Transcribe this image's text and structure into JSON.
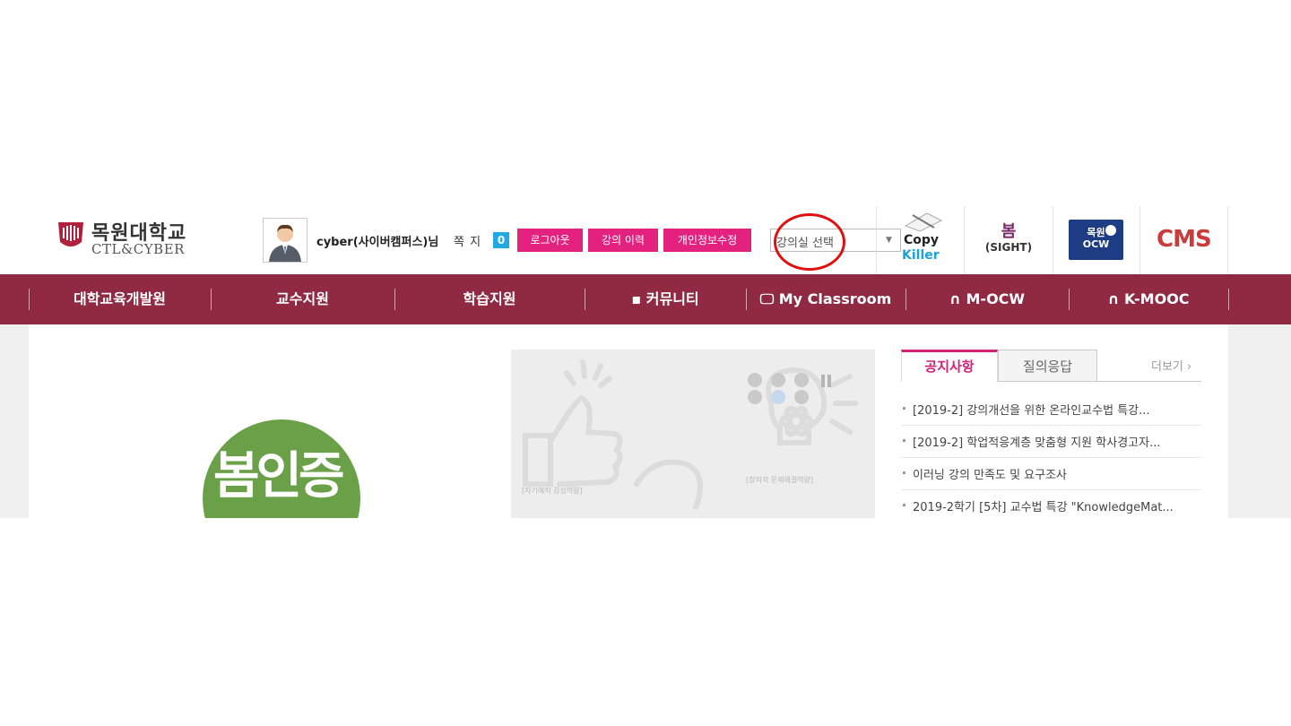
{
  "header": {
    "logo_title": "목원대학교",
    "logo_subtitle": "CTL&CYBER",
    "username": "cyber(사이버캠퍼스)님",
    "message_label": "쪽 지",
    "message_count": "0",
    "logout_label": "로그아웃",
    "history_label": "강의 이력",
    "profile_edit_label": "개인정보수정",
    "course_select": {
      "selected": "강의실 선택"
    },
    "services": {
      "copykiller_line1": "Copy",
      "copykiller_line2": "Killer",
      "sight_top": "봄",
      "sight_bottom": "(SIGHT)",
      "ocw_line1": "목원",
      "ocw_line2": "OCW",
      "cms_label": "CMS"
    }
  },
  "nav": {
    "items": [
      "대학교육개발원",
      "교수지원",
      "학습지원",
      "커뮤니티",
      "My Classroom",
      "M-OCW",
      "K-MOOC"
    ]
  },
  "main": {
    "bom_badge": "봄인증",
    "banner": {
      "caption_left": "[자기애적 감성역량]",
      "caption_right": "[창의적 문제해결역량]"
    },
    "board": {
      "tabs": [
        "공지사항",
        "질의응답"
      ],
      "more_label": "더보기",
      "notices": [
        "[2019-2] 강의개선을 위한 온라인교수법 특강...",
        "[2019-2] 학업적응계층 맞춤형 지원 학사경고자...",
        "이러닝 강의 만족도 및 요구조사",
        "2019-2학기 [5차] 교수법 특강 \"KnowledgeMat..."
      ]
    }
  },
  "colors": {
    "nav_bg": "#8f2a42",
    "accent_pink": "#e2227e",
    "message_blue": "#22a9e2",
    "annotation_red": "#e01010"
  }
}
